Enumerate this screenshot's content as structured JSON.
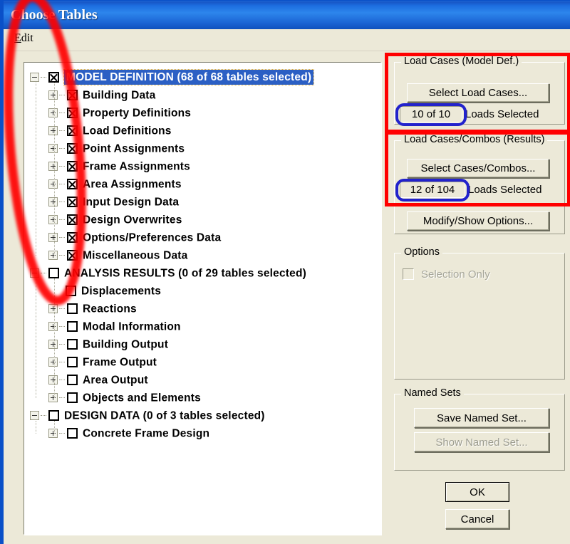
{
  "window": {
    "title": "Choose Tables",
    "menu": [
      {
        "label": "Edit",
        "accel": "E"
      }
    ]
  },
  "tree": {
    "rows": [
      {
        "label": "MODEL DEFINITION  (68 of 68 tables selected)",
        "level": 0,
        "checked": true,
        "expander": "minus",
        "selected": true
      },
      {
        "label": "Building Data",
        "level": 1,
        "checked": true,
        "expander": "plus",
        "selected": false
      },
      {
        "label": "Property Definitions",
        "level": 1,
        "checked": true,
        "expander": "plus",
        "selected": false
      },
      {
        "label": "Load Definitions",
        "level": 1,
        "checked": true,
        "expander": "plus",
        "selected": false
      },
      {
        "label": "Point Assignments",
        "level": 1,
        "checked": true,
        "expander": "plus",
        "selected": false
      },
      {
        "label": "Frame Assignments",
        "level": 1,
        "checked": true,
        "expander": "plus",
        "selected": false
      },
      {
        "label": "Area Assignments",
        "level": 1,
        "checked": true,
        "expander": "plus",
        "selected": false
      },
      {
        "label": "Input Design Data",
        "level": 1,
        "checked": true,
        "expander": "plus",
        "selected": false
      },
      {
        "label": "Design Overwrites",
        "level": 1,
        "checked": true,
        "expander": "plus",
        "selected": false
      },
      {
        "label": "Options/Preferences Data",
        "level": 1,
        "checked": true,
        "expander": "plus",
        "selected": false
      },
      {
        "label": "Miscellaneous Data",
        "level": 1,
        "checked": true,
        "expander": "plus",
        "selected": false
      },
      {
        "label": "ANALYSIS RESULTS  (0 of 29 tables selected)",
        "level": 0,
        "checked": false,
        "expander": "minus",
        "selected": false
      },
      {
        "label": "Displacements",
        "level": 1,
        "checked": false,
        "expander": "none",
        "selected": false
      },
      {
        "label": "Reactions",
        "level": 1,
        "checked": false,
        "expander": "plus",
        "selected": false
      },
      {
        "label": "Modal Information",
        "level": 1,
        "checked": false,
        "expander": "plus",
        "selected": false
      },
      {
        "label": "Building Output",
        "level": 1,
        "checked": false,
        "expander": "plus",
        "selected": false
      },
      {
        "label": "Frame Output",
        "level": 1,
        "checked": false,
        "expander": "plus",
        "selected": false
      },
      {
        "label": "Area Output",
        "level": 1,
        "checked": false,
        "expander": "plus",
        "selected": false
      },
      {
        "label": "Objects and Elements",
        "level": 1,
        "checked": false,
        "expander": "plus",
        "selected": false
      },
      {
        "label": "DESIGN DATA  (0 of 3 tables selected)",
        "level": 0,
        "checked": false,
        "expander": "minus",
        "selected": false
      },
      {
        "label": "Concrete Frame Design",
        "level": 1,
        "checked": false,
        "expander": "plus",
        "selected": false
      }
    ]
  },
  "load_cases_model_def": {
    "group_title": "Load Cases (Model Def.)",
    "select_button": "Select Load Cases...",
    "count": "10  of  10",
    "count_label": "Loads Selected"
  },
  "load_cases_results": {
    "group_title": "Load Cases/Combos (Results)",
    "select_button": "Select Cases/Combos...",
    "count": "12  of  104",
    "count_label": "Loads Selected",
    "modify_button": "Modify/Show Options..."
  },
  "options": {
    "group_title": "Options",
    "selection_only_label": "Selection Only",
    "selection_only_checked": false,
    "selection_only_enabled": false
  },
  "named_sets": {
    "group_title": "Named Sets",
    "save_button": "Save Named Set...",
    "show_button": "Show Named Set...",
    "show_enabled": false
  },
  "dialog_buttons": {
    "ok": "OK",
    "cancel": "Cancel"
  },
  "annotations": {
    "ellipse_color": "#ff0000",
    "box_color": "#ff0000",
    "highlight_color": "#2222cc"
  }
}
